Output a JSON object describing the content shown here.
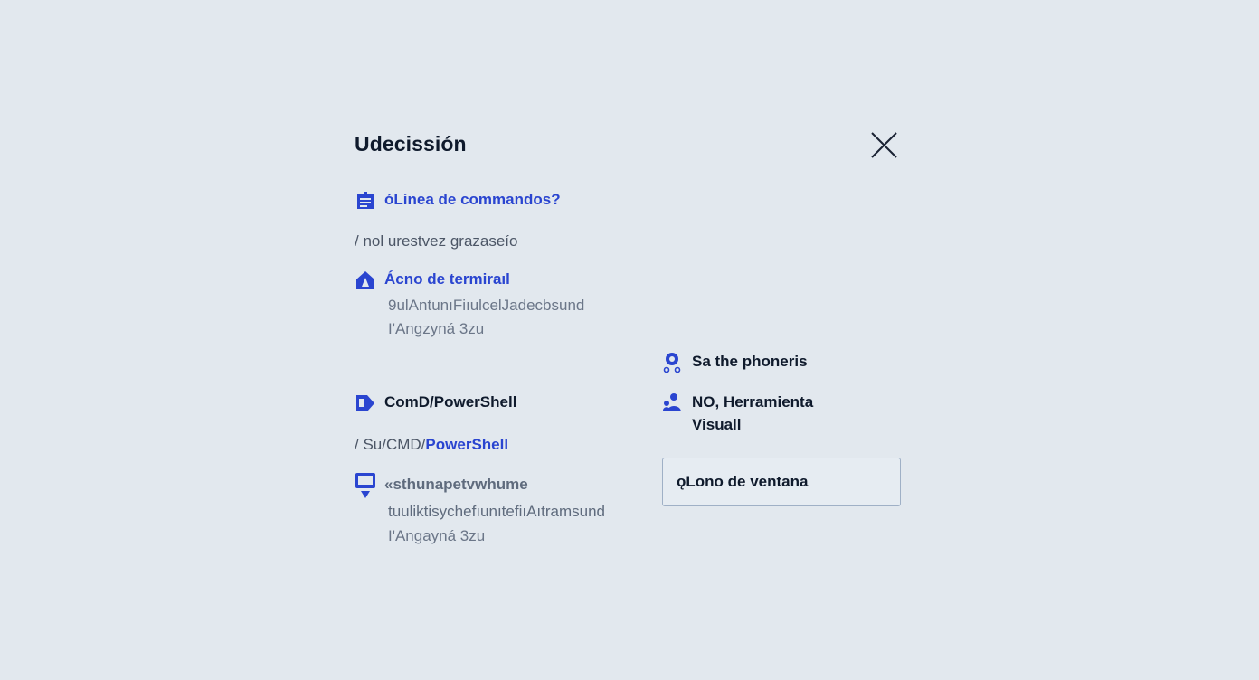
{
  "dialog": {
    "title": "Udecissión"
  },
  "question": {
    "label": "óLinea de commandos?"
  },
  "path_hint": "/ nol urestvez grazaseío",
  "options": [
    {
      "icon": "house-icon",
      "label": "Ácno de termiraıl",
      "desc_line1": "9ulAntunıFiıulcelJadecbsund",
      "desc_line2": "I'Angzyná 3zu"
    },
    {
      "icon": "terminal-arrow-icon",
      "label": "ComD/PowerShell",
      "path_prefix": "/ Su/",
      "path_mid": "CMD/",
      "path_highlight": "PowerShell"
    },
    {
      "icon": "monitor-icon",
      "label": "«sthunapetvwhume",
      "desc_line1": "tuuliktisychefıunıtefiıAıtramsund",
      "desc_line2": "I'Angayná 3zu"
    }
  ],
  "right_options": [
    {
      "icon": "location-pin-icon",
      "label": "Sa the phoneris"
    },
    {
      "icon": "people-icon",
      "label_line1": "NO, Herramienta",
      "label_line2": "Visuall"
    }
  ],
  "window_button": {
    "label": "ǫLono de ventana"
  },
  "colors": {
    "accent": "#2a45d0",
    "text": "#0f1a2c",
    "muted": "#6b7688",
    "background": "#e2e8ee",
    "border": "#9fb0c6"
  }
}
